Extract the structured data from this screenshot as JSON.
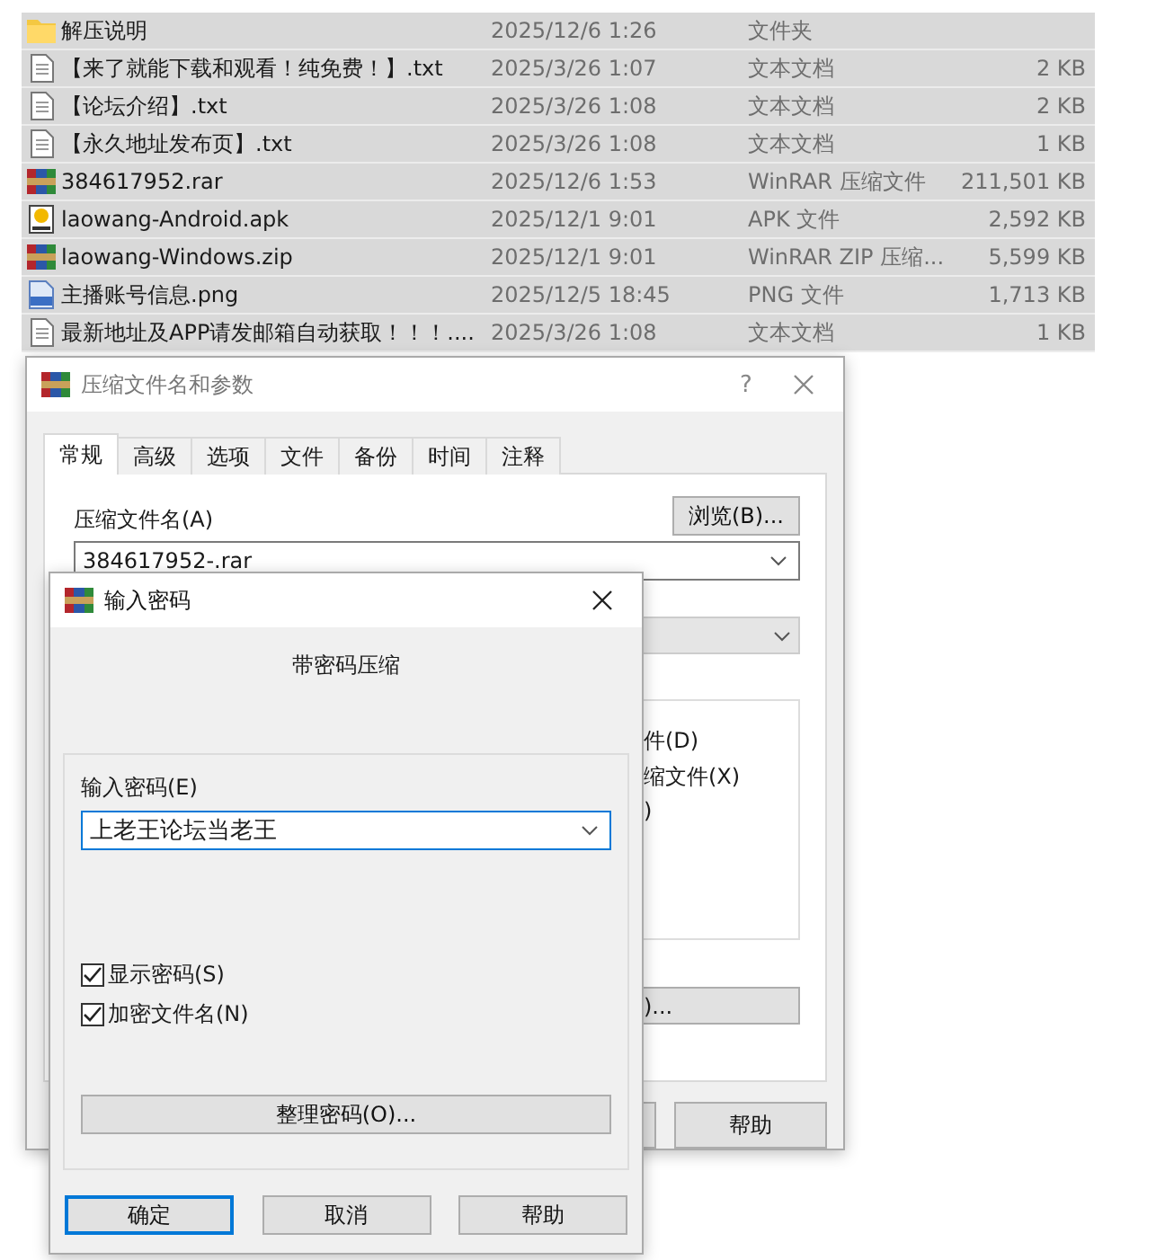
{
  "files": [
    {
      "name": "解压说明",
      "date": "2025/12/6 1:26",
      "type": "文件夹",
      "kind": "folder",
      "selected": true
    },
    {
      "name": "【来了就能下载和观看！纯免费！】.txt",
      "date": "2025/3/26 1:07",
      "type": "文本文档",
      "size": "2 KB",
      "kind": "text",
      "selected": true
    },
    {
      "name": "【论坛介绍】.txt",
      "date": "2025/3/26 1:08",
      "type": "文本文档",
      "size": "2 KB",
      "kind": "text",
      "selected": true
    },
    {
      "name": "【永久地址发布页】.txt",
      "date": "2025/3/26 1:08",
      "type": "文本文档",
      "size": "1 KB",
      "kind": "text",
      "selected": true
    },
    {
      "name": "384617952.rar",
      "date": "2025/12/6 1:53",
      "type": "WinRAR 压缩文件",
      "size": "211,501 KB",
      "kind": "rar",
      "selected": true
    },
    {
      "name": "laowang-Android.apk",
      "date": "2025/12/1 9:01",
      "type": "APK 文件",
      "size": "2,592 KB",
      "kind": "apk",
      "selected": true
    },
    {
      "name": "laowang-Windows.zip",
      "date": "2025/12/1 9:01",
      "type": "WinRAR ZIP 压缩...",
      "size": "5,599 KB",
      "kind": "rar",
      "selected": true
    },
    {
      "name": "主播账号信息.png",
      "date": "2025/12/5 18:45",
      "type": "PNG 文件",
      "size": "1,713 KB",
      "kind": "png",
      "selected": true
    },
    {
      "name": "最新地址及APP请发邮箱自动获取！！！....",
      "date": "2025/3/26 1:08",
      "type": "文本文档",
      "size": "1 KB",
      "kind": "text",
      "selected": true
    }
  ],
  "archive_dialog": {
    "title": "压缩文件名和参数",
    "help": "?",
    "tabs": [
      {
        "label": "常规",
        "selected": true
      },
      {
        "label": "高级",
        "selected": false
      },
      {
        "label": "选项",
        "selected": false
      },
      {
        "label": "文件",
        "selected": false
      },
      {
        "label": "备份",
        "selected": false
      },
      {
        "label": "时间",
        "selected": false
      },
      {
        "label": "注释",
        "selected": false
      }
    ],
    "archive_name_label": "压缩文件名(A)",
    "browse_button": "浏览(B)...",
    "archive_name": "384617952-.rar",
    "option_fragments": [
      "件(D)",
      "缩文件(X)",
      ")"
    ],
    "button_fragment": ")...",
    "help_button": "帮助"
  },
  "password_dialog": {
    "title": "输入密码",
    "heading": "带密码压缩",
    "password_label": "输入密码(E)",
    "password": "上老王论坛当老王",
    "checkboxes": [
      {
        "label": "显示密码(S)",
        "checked": true
      },
      {
        "label": "加密文件名(N)",
        "checked": true
      }
    ],
    "organize_button": "整理密码(O)...",
    "buttons": [
      {
        "label": "确定",
        "default": true
      },
      {
        "label": "取消",
        "default": false
      },
      {
        "label": "帮助",
        "default": false
      }
    ]
  }
}
